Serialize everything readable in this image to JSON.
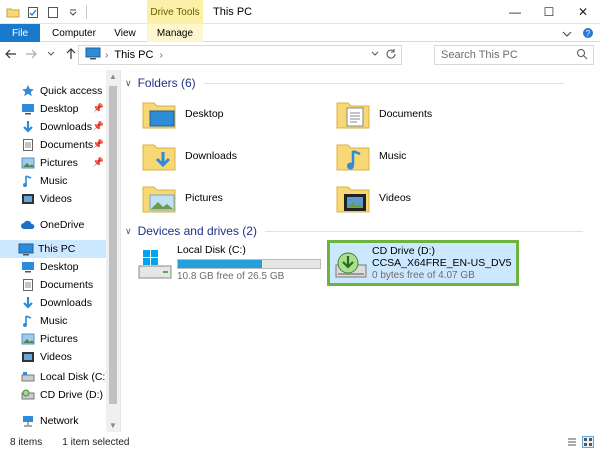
{
  "titlebar": {
    "contextual_tab": "Drive Tools",
    "title": "This PC",
    "minimize": "—",
    "maximize": "☐",
    "close": "✕"
  },
  "ribbon": {
    "tabs": [
      {
        "label": "File"
      },
      {
        "label": "Computer"
      },
      {
        "label": "View"
      },
      {
        "label": "Manage"
      }
    ]
  },
  "address": {
    "path": "This PC",
    "separator": "›",
    "search_placeholder": "Search This PC"
  },
  "nav_pane": {
    "items": [
      {
        "label": "Quick access",
        "icon": "star-icon"
      },
      {
        "label": "Desktop",
        "icon": "desktop-icon",
        "pinned": true
      },
      {
        "label": "Downloads",
        "icon": "download-arrow-icon",
        "pinned": true
      },
      {
        "label": "Documents",
        "icon": "documents-icon",
        "pinned": true
      },
      {
        "label": "Pictures",
        "icon": "pictures-icon",
        "pinned": true
      },
      {
        "label": "Music",
        "icon": "music-note-icon"
      },
      {
        "label": "Videos",
        "icon": "videos-icon"
      },
      {
        "label": "OneDrive",
        "icon": "cloud-icon"
      },
      {
        "label": "This PC",
        "icon": "computer-icon",
        "selected": true
      },
      {
        "label": "Desktop",
        "icon": "desktop-icon"
      },
      {
        "label": "Documents",
        "icon": "documents-icon"
      },
      {
        "label": "Downloads",
        "icon": "download-arrow-icon"
      },
      {
        "label": "Music",
        "icon": "music-note-icon"
      },
      {
        "label": "Pictures",
        "icon": "pictures-icon"
      },
      {
        "label": "Videos",
        "icon": "videos-icon"
      },
      {
        "label": "Local Disk (C:)",
        "icon": "hard-drive-icon"
      },
      {
        "label": "CD Drive (D:) CC",
        "icon": "cd-drive-icon"
      },
      {
        "label": "Network",
        "icon": "network-icon"
      }
    ]
  },
  "folders": {
    "heading": "Folders (6)",
    "items": [
      {
        "label": "Desktop",
        "icon": "desktop-folder-icon"
      },
      {
        "label": "Documents",
        "icon": "documents-folder-icon"
      },
      {
        "label": "Downloads",
        "icon": "downloads-folder-icon"
      },
      {
        "label": "Music",
        "icon": "music-folder-icon"
      },
      {
        "label": "Pictures",
        "icon": "pictures-folder-icon"
      },
      {
        "label": "Videos",
        "icon": "videos-folder-icon"
      }
    ]
  },
  "drives": {
    "heading": "Devices and drives (2)",
    "items": [
      {
        "name": "Local Disk (C:)",
        "free": "10.8 GB free of 26.5 GB",
        "used_fraction": 0.59,
        "icon": "windows-drive-icon"
      },
      {
        "name": "CD Drive (D:)",
        "label": "CCSA_X64FRE_EN-US_DV5",
        "free": "0 bytes free of 4.07 GB",
        "icon": "cd-drive-icon",
        "selected": true
      }
    ]
  },
  "status": {
    "count": "8 items",
    "selected": "1 item selected"
  },
  "colors": {
    "accent": "#1979ca",
    "selection": "#cce8ff",
    "highlight_border": "#6db33f",
    "group_heading": "#1e3287",
    "drive_fill": "#26a0da",
    "folder_yellow": "#f8d775"
  }
}
